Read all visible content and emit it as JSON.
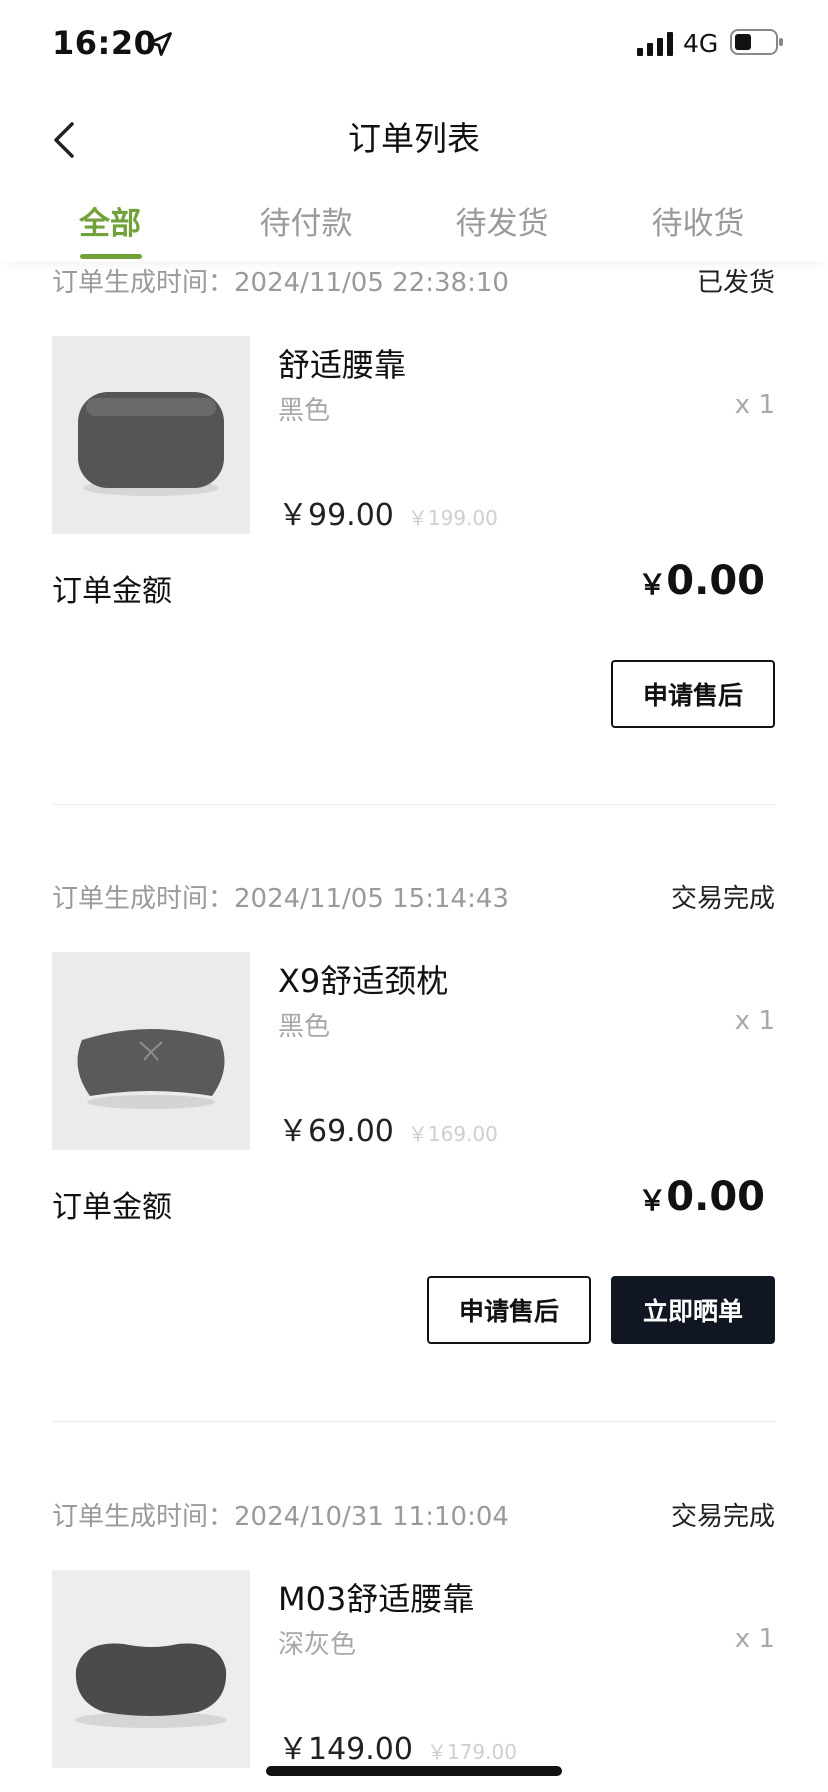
{
  "status_bar": {
    "time": "16:20",
    "network": "4G"
  },
  "nav": {
    "title": "订单列表"
  },
  "tabs": [
    {
      "label": "全部",
      "active": true
    },
    {
      "label": "待付款",
      "active": false
    },
    {
      "label": "待发货",
      "active": false
    },
    {
      "label": "待收货",
      "active": false
    }
  ],
  "orders": [
    {
      "created_label": "订单生成时间：",
      "created_time": "2024/11/05 22:38:10",
      "status": "已发货",
      "product_name": "舒适腰靠",
      "variant": "黑色",
      "quantity": "x 1",
      "price": "￥99.00",
      "original_price": "￥199.00",
      "amount_label": "订单金额",
      "amount_currency": "￥",
      "amount_value": "0.00",
      "buttons": [
        "申请售后"
      ]
    },
    {
      "created_label": "订单生成时间：",
      "created_time": "2024/11/05 15:14:43",
      "status": "交易完成",
      "product_name": "X9舒适颈枕",
      "variant": "黑色",
      "quantity": "x 1",
      "price": "￥69.00",
      "original_price": "￥169.00",
      "amount_label": "订单金额",
      "amount_currency": "￥",
      "amount_value": "0.00",
      "buttons": [
        "申请售后",
        "立即晒单"
      ]
    },
    {
      "created_label": "订单生成时间：",
      "created_time": "2024/10/31 11:10:04",
      "status": "交易完成",
      "product_name": "M03舒适腰靠",
      "variant": "深灰色",
      "quantity": "x 1",
      "price": "￥149.00",
      "original_price": "￥179.00"
    }
  ],
  "colors": {
    "accent": "#72a13b",
    "dark_button": "#111722",
    "muted_text": "#9a9a9a"
  },
  "icons": {
    "location": "location-arrow-icon",
    "signal": "cellular-signal-icon",
    "battery": "battery-icon",
    "back": "chevron-left-icon"
  }
}
